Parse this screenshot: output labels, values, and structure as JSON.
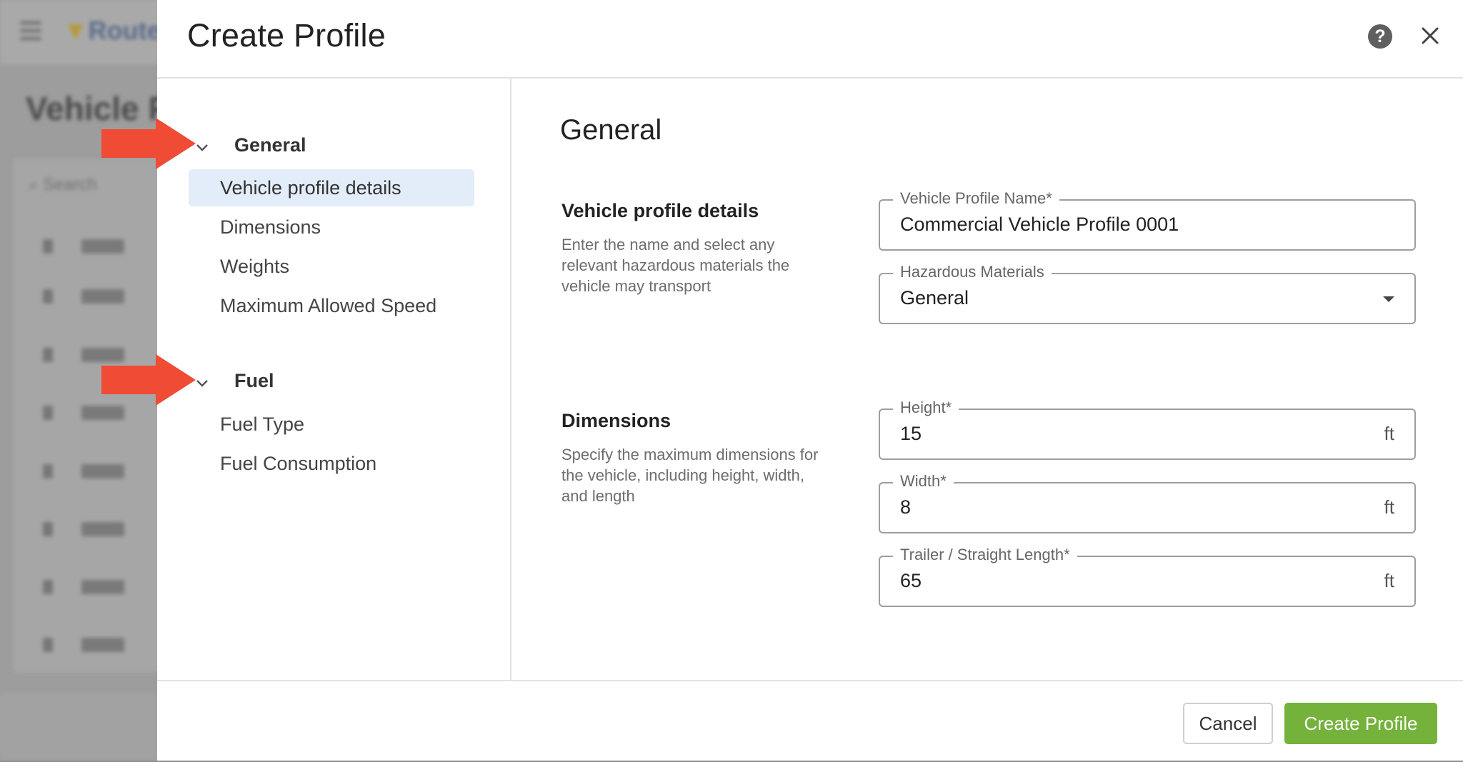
{
  "background": {
    "logo_text": "Route",
    "page_title": "Vehicle Pr",
    "search_placeholder": "Search"
  },
  "dialog": {
    "title": "Create Profile",
    "help_icon": "?",
    "close_icon": "close-icon"
  },
  "nav": {
    "groups": [
      {
        "label": "General",
        "items": [
          {
            "label": "Vehicle profile details",
            "active": true
          },
          {
            "label": "Dimensions",
            "active": false
          },
          {
            "label": "Weights",
            "active": false
          },
          {
            "label": "Maximum Allowed Speed",
            "active": false
          }
        ]
      },
      {
        "label": "Fuel",
        "items": [
          {
            "label": "Fuel Type",
            "active": false
          },
          {
            "label": "Fuel Consumption",
            "active": false
          }
        ]
      }
    ]
  },
  "content": {
    "section_title": "General",
    "vehicle_details": {
      "title": "Vehicle profile details",
      "description": "Enter the name and select any relevant hazardous materials the vehicle may transport",
      "name_field": {
        "label": "Vehicle Profile Name*",
        "value": "Commercial Vehicle Profile 0001"
      },
      "hazmat_field": {
        "label": "Hazardous Materials",
        "value": "General"
      }
    },
    "dimensions": {
      "title": "Dimensions",
      "description": "Specify the maximum dimensions for the vehicle, including height, width, and length",
      "height": {
        "label": "Height*",
        "value": "15",
        "unit": "ft"
      },
      "width": {
        "label": "Width*",
        "value": "8",
        "unit": "ft"
      },
      "length": {
        "label": "Trailer / Straight Length*",
        "value": "65",
        "unit": "ft"
      }
    }
  },
  "footer": {
    "cancel_label": "Cancel",
    "create_label": "Create Profile"
  },
  "colors": {
    "primary_button": "#74b23b",
    "nav_active_bg": "#e3edfa",
    "annotation_arrow": "#ef4b35"
  }
}
